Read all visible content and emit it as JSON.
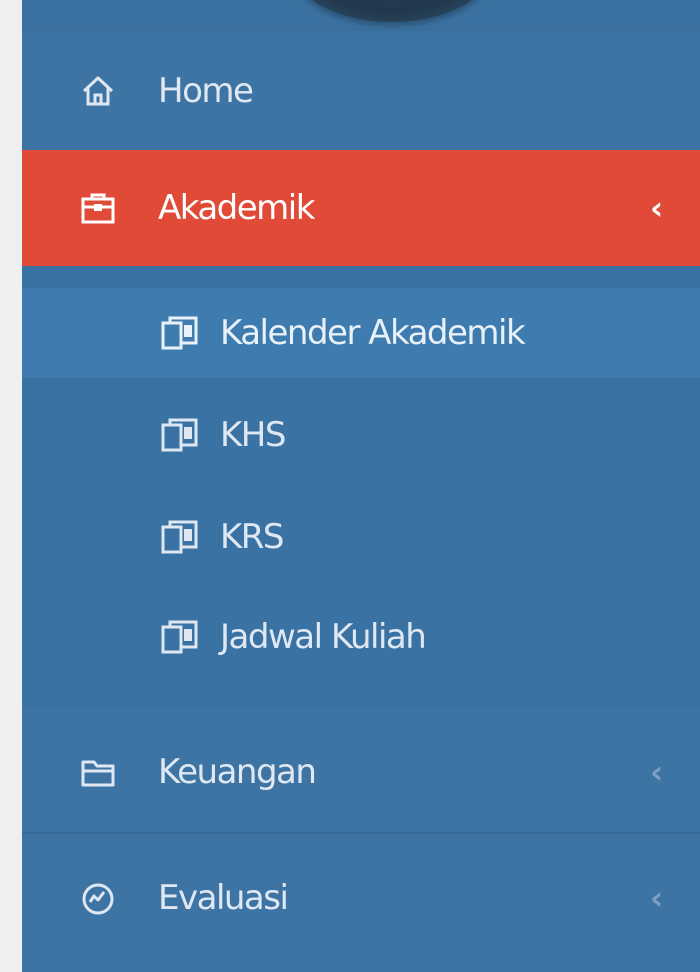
{
  "sidebar": {
    "items": [
      {
        "label": "Home",
        "icon": "home-icon",
        "has_submenu": false,
        "active": false
      },
      {
        "label": "Akademik",
        "icon": "briefcase-icon",
        "has_submenu": true,
        "active": true,
        "expanded": true
      },
      {
        "label": "Keuangan",
        "icon": "folder-icon",
        "has_submenu": true,
        "active": false
      },
      {
        "label": "Evaluasi",
        "icon": "dashboard-icon",
        "has_submenu": true,
        "active": false
      }
    ],
    "akademik_submenu": [
      {
        "label": "Kalender Akademik",
        "icon": "document-icon",
        "highlighted": true
      },
      {
        "label": "KHS",
        "icon": "document-icon",
        "highlighted": false
      },
      {
        "label": "KRS",
        "icon": "document-icon",
        "highlighted": false
      },
      {
        "label": "Jadwal Kuliah",
        "icon": "document-icon",
        "highlighted": false
      }
    ],
    "chevron_glyph": "‹"
  },
  "colors": {
    "sidebar_bg": "#3d74a4",
    "active_bg": "#e04a36",
    "text": "#dfe8f2",
    "page_bg": "#eeeff1"
  }
}
